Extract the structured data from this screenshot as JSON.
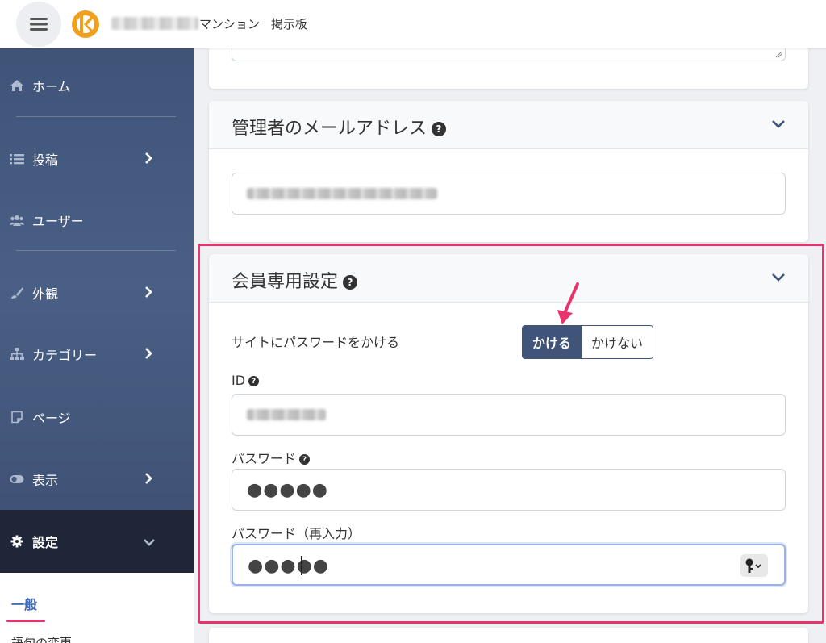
{
  "header": {
    "site_name_suffix": "マンション",
    "site_section": "掲示板"
  },
  "sidebar": {
    "items": [
      {
        "label": "ホーム",
        "icon": "home-icon"
      },
      {
        "label": "投稿",
        "icon": "list-icon"
      },
      {
        "label": "ユーザー",
        "icon": "users-icon"
      },
      {
        "label": "外観",
        "icon": "brush-icon"
      },
      {
        "label": "カテゴリー",
        "icon": "sitemap-icon"
      },
      {
        "label": "ページ",
        "icon": "page-icon"
      },
      {
        "label": "表示",
        "icon": "toggle-icon"
      },
      {
        "label": "設定",
        "icon": "gear-icon"
      }
    ],
    "sub_items": [
      {
        "label": "一般"
      },
      {
        "label": "語句の変更"
      }
    ]
  },
  "admin_email": {
    "title": "管理者のメールアドレス",
    "help": "?"
  },
  "member": {
    "title": "会員専用設定",
    "help": "?",
    "password_protect_label": "サイトにパスワードをかける",
    "toggle_on": "かける",
    "toggle_off": "かけない",
    "id_label": "ID",
    "password_label": "パスワード",
    "password_confirm_label": "パスワード（再入力）",
    "password_value": "●●●●●",
    "password_confirm_value": "●●●●●"
  },
  "colors": {
    "accent": "#3f5478",
    "highlight": "#e8336d",
    "active_link": "#3f69ba"
  }
}
